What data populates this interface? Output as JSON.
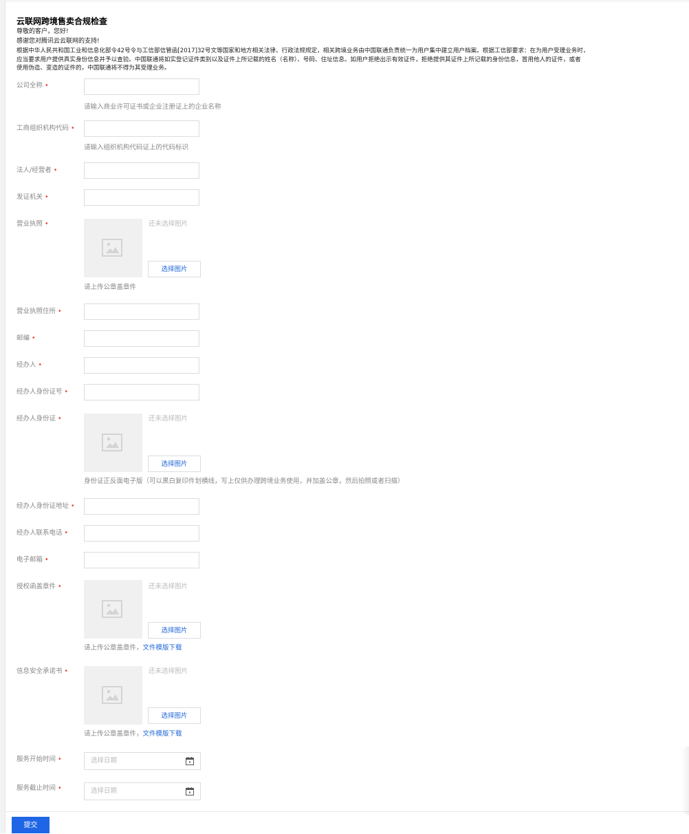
{
  "page": {
    "title": "云联网跨境售卖合规检查",
    "greeting": "尊敬的客户，您好!",
    "thanks": "感谢您对腾讯云云联网的支持!",
    "notice_lines": [
      "根据中华人民共和国工业和信息化部令42号令与工信部信管函[2017]32号文等国家和地方相关法律、行政法规规定，相关跨境业务由中国联通负责统一为用户集中建立用户档案。根据工信部要求：在为用户受理业务时，",
      "应当要求用户提供真实身份信息并予以查验。中国联通将如实登记证件类别以及证件上所记载的姓名（名称）、号码、住址信息。如用户拒绝出示有效证件，拒绝提供其证件上所记载的身份信息，冒用他人的证件，或者",
      "使用伪造、变造的证件的，中国联通将不得为其受理业务。"
    ]
  },
  "required_mark": "•",
  "fields": {
    "company_name": {
      "label": "公司全称",
      "help": "请输入商业许可证书或企业注册证上的企业名称",
      "value": ""
    },
    "org_code": {
      "label": "工商组织机构代码",
      "help": "请输入组织机构代码证上的代码标识",
      "value": ""
    },
    "legal_person": {
      "label": "法人/经营者",
      "value": ""
    },
    "issuer": {
      "label": "发证机关",
      "value": ""
    },
    "business_license": {
      "label": "营业执照",
      "status": "还未选择图片",
      "button": "选择图片",
      "help": "请上传公章盖章件"
    },
    "license_address": {
      "label": "营业执照住所",
      "value": ""
    },
    "postcode": {
      "label": "邮编",
      "value": ""
    },
    "agent": {
      "label": "经办人",
      "value": ""
    },
    "agent_id_number": {
      "label": "经办人身份证号",
      "value": ""
    },
    "agent_id_card": {
      "label": "经办人身份证",
      "status": "还未选择图片",
      "button": "选择图片",
      "help": "身份证正反面电子版（可以黑白复印件划横线，写上仅供办理跨境业务使用，并加盖公章，然后拍照或者扫描）"
    },
    "agent_id_address": {
      "label": "经办人身份证地址",
      "value": ""
    },
    "agent_phone": {
      "label": "经办人联系电话",
      "value": ""
    },
    "email": {
      "label": "电子邮箱",
      "value": ""
    },
    "authorization_letter": {
      "label": "授权函盖章件",
      "status": "还未选择图片",
      "button": "选择图片",
      "help": "请上传公章盖章件，",
      "link": "文件模版下载"
    },
    "security_commitment": {
      "label": "信息安全承诺书",
      "status": "还未选择图片",
      "button": "选择图片",
      "help": "请上传公章盖章件，",
      "link": "文件模版下载"
    },
    "service_start": {
      "label": "服务开始时间",
      "placeholder": "选择日期"
    },
    "service_end": {
      "label": "服务截止时间",
      "placeholder": "选择日期"
    }
  },
  "actions": {
    "submit": "提交"
  },
  "colors": {
    "accent": "#1f66e6",
    "link": "#1f66d6",
    "required": "#e54545"
  },
  "icons": {
    "image_placeholder": "image-placeholder-icon",
    "calendar": "calendar-icon"
  }
}
